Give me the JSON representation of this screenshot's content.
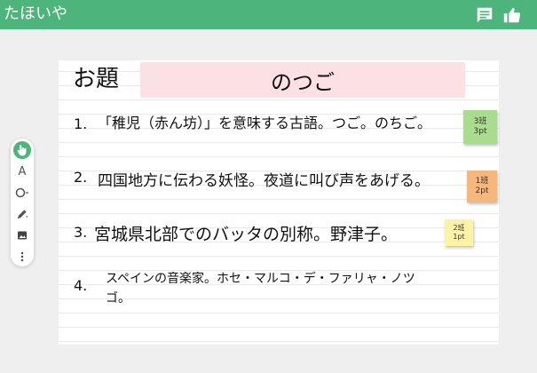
{
  "app": {
    "title": "たほいや",
    "icons": {
      "comment": "comment-icon",
      "like": "thumbs-up-icon"
    },
    "colors": {
      "header": "#4db57b",
      "theme_box": "#fbe1e4"
    }
  },
  "board": {
    "odai_label": "お題",
    "theme": "のつご",
    "questions": [
      {
        "number": "1.",
        "text": "「稚児（赤ん坊）」を意味する古語。つご。のちご。",
        "tag": {
          "group": "3班",
          "points": "3pt",
          "color": "#a9dc8f"
        }
      },
      {
        "number": "2.",
        "text": "四国地方に伝わる妖怪。夜道に叫び声をあげる。",
        "tag": {
          "group": "1班",
          "points": "2pt",
          "color": "#f7b77a"
        }
      },
      {
        "number": "3.",
        "text": "宮城県北部でのバッタの別称。野津子。",
        "tag": {
          "group": "2班",
          "points": "1pt",
          "color": "#fdf3a6"
        }
      },
      {
        "number": "4.",
        "text_line1": "スペインの音楽家。ホセ・マルコ・デ・ファリャ・ノツ",
        "text_line2": "ゴ。"
      }
    ]
  },
  "toolbar": {
    "tools": [
      "hand-pointer-icon",
      "text-tool-icon",
      "shape-tool-icon",
      "pen-tool-icon",
      "image-tool-icon",
      "more-icon"
    ],
    "text_tool_glyph": "A"
  }
}
